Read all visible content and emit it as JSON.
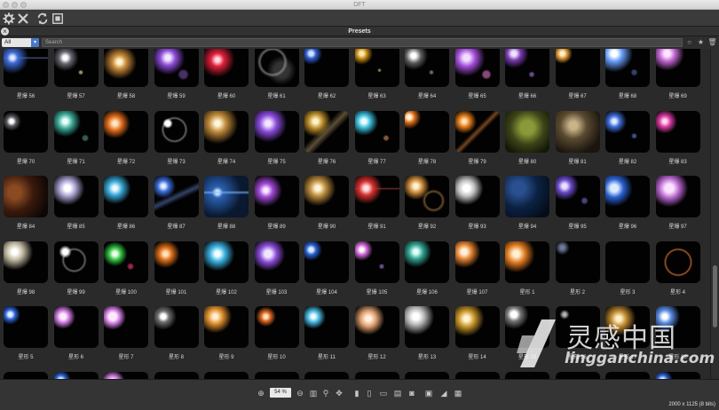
{
  "window": {
    "title": "DFT"
  },
  "panel": {
    "title": "Presets"
  },
  "filter": {
    "category_selected": "All",
    "search_placeholder": "Search"
  },
  "grid": {
    "rows": [
      [
        {
          "label": "星爆 56",
          "fx": "blue-streak"
        },
        {
          "label": "星爆 57",
          "fx": "white-star-dots"
        },
        {
          "label": "星爆 58",
          "fx": "warm-glow"
        },
        {
          "label": "星爆 59",
          "fx": "purple-flare"
        },
        {
          "label": "星爆 60",
          "fx": "red-star"
        },
        {
          "label": "星爆 61",
          "fx": "ring"
        },
        {
          "label": "星爆 62",
          "fx": "blue-dot"
        },
        {
          "label": "星爆 63",
          "fx": "gold-dots"
        },
        {
          "label": "星爆 64",
          "fx": "white-streak"
        },
        {
          "label": "星爆 65",
          "fx": "violet-orb"
        },
        {
          "label": "星爆 66",
          "fx": "violet-dots"
        },
        {
          "label": "星爆 67",
          "fx": "amber-dot"
        },
        {
          "label": "星爆 68",
          "fx": "blue-white-flare"
        },
        {
          "label": "星爆 69",
          "fx": "pink-glow"
        }
      ],
      [
        {
          "label": "星爆 70",
          "fx": "small-white"
        },
        {
          "label": "星爆 71",
          "fx": "teal-flare"
        },
        {
          "label": "星爆 72",
          "fx": "orange-star"
        },
        {
          "label": "星爆 73",
          "fx": "halo-rings"
        },
        {
          "label": "星爆 74",
          "fx": "gold-burst"
        },
        {
          "label": "星爆 75",
          "fx": "violet-burst"
        },
        {
          "label": "星爆 76",
          "fx": "gold-streak"
        },
        {
          "label": "星爆 77",
          "fx": "cyan-dots"
        },
        {
          "label": "星爆 78",
          "fx": "orange-corner"
        },
        {
          "label": "星爆 79",
          "fx": "orange-chain"
        },
        {
          "label": "星爆 80",
          "fx": "olive-haze"
        },
        {
          "label": "星爆 81",
          "fx": "brown-haze"
        },
        {
          "label": "星爆 82",
          "fx": "blue-dots"
        },
        {
          "label": "星爆 83",
          "fx": "magenta-star"
        }
      ],
      [
        {
          "label": "星爆 84",
          "fx": "copper-haze"
        },
        {
          "label": "星爆 85",
          "fx": "white-burst"
        },
        {
          "label": "星爆 86",
          "fx": "cyan-star"
        },
        {
          "label": "星爆 87",
          "fx": "blue-chain"
        },
        {
          "label": "星爆 88",
          "fx": "blue-line"
        },
        {
          "label": "星爆 89",
          "fx": "purple-star"
        },
        {
          "label": "星爆 90",
          "fx": "warm-flare"
        },
        {
          "label": "星爆 91",
          "fx": "red-flare"
        },
        {
          "label": "星爆 92",
          "fx": "amber-rings"
        },
        {
          "label": "星爆 93",
          "fx": "white-spike"
        },
        {
          "label": "星爆 94",
          "fx": "navy-haze"
        },
        {
          "label": "星爆 95",
          "fx": "violet-lens"
        },
        {
          "label": "星爆 96",
          "fx": "blue-orb"
        },
        {
          "label": "星爆 97",
          "fx": "pink-orb"
        }
      ],
      [
        {
          "label": "星爆 98",
          "fx": "silver-burst"
        },
        {
          "label": "星爆 99",
          "fx": "ring-burst"
        },
        {
          "label": "星爆 100",
          "fx": "rgb-flare"
        },
        {
          "label": "星爆 101",
          "fx": "orange-spike"
        },
        {
          "label": "星爆 102",
          "fx": "cyan-burst"
        },
        {
          "label": "星爆 103",
          "fx": "purple-orb"
        },
        {
          "label": "星爆 104",
          "fx": "blue-small"
        },
        {
          "label": "星爆 105",
          "fx": "pink-dots"
        },
        {
          "label": "星爆 106",
          "fx": "teal-lens"
        },
        {
          "label": "星爆 107",
          "fx": "orange-orb"
        },
        {
          "label": "星形 1",
          "fx": "orange-star-lg"
        },
        {
          "label": "星形 2",
          "fx": "faint-blue"
        },
        {
          "label": "星形 3",
          "fx": "dark"
        },
        {
          "label": "星形 4",
          "fx": "orange-ring"
        }
      ],
      [
        {
          "label": "星形 5",
          "fx": "blue-tiny"
        },
        {
          "label": "星形 6",
          "fx": "pink-tiny"
        },
        {
          "label": "星形 7",
          "fx": "pink-ring"
        },
        {
          "label": "星形 8",
          "fx": "white-star"
        },
        {
          "label": "星形 9",
          "fx": "amber-star"
        },
        {
          "label": "星形 10",
          "fx": "orange-dot"
        },
        {
          "label": "星形 11",
          "fx": "cyan-star-sm"
        },
        {
          "label": "星形 12",
          "fx": "peach-star"
        },
        {
          "label": "星形 13",
          "fx": "white-star-lg"
        },
        {
          "label": "星形 14",
          "fx": "gold-star"
        },
        {
          "label": "星形 15",
          "fx": "white-flower"
        },
        {
          "label": "星形 16",
          "fx": "faint-white"
        },
        {
          "label": "星形 17",
          "fx": "gold-flare"
        },
        {
          "label": "星形 18",
          "fx": "blue-white"
        }
      ],
      [
        {
          "label": "",
          "fx": "dark"
        },
        {
          "label": "",
          "fx": "blue-tiny"
        },
        {
          "label": "",
          "fx": "pink-tiny"
        },
        {
          "label": "",
          "fx": "dark"
        },
        {
          "label": "",
          "fx": "dark"
        },
        {
          "label": "",
          "fx": "dark"
        },
        {
          "label": "",
          "fx": "dark"
        },
        {
          "label": "",
          "fx": "dark"
        },
        {
          "label": "",
          "fx": "dark"
        },
        {
          "label": "",
          "fx": "dark"
        },
        {
          "label": "",
          "fx": "dark"
        },
        {
          "label": "",
          "fx": "dark"
        },
        {
          "label": "",
          "fx": "dark"
        },
        {
          "label": "",
          "fx": "blue-tiny"
        }
      ]
    ]
  },
  "footer": {
    "zoom": "54 %",
    "resolution": "2000 x 1125 (8 bits)"
  },
  "watermark": {
    "cn": "灵感中国",
    "en": "lingganchina.com"
  }
}
